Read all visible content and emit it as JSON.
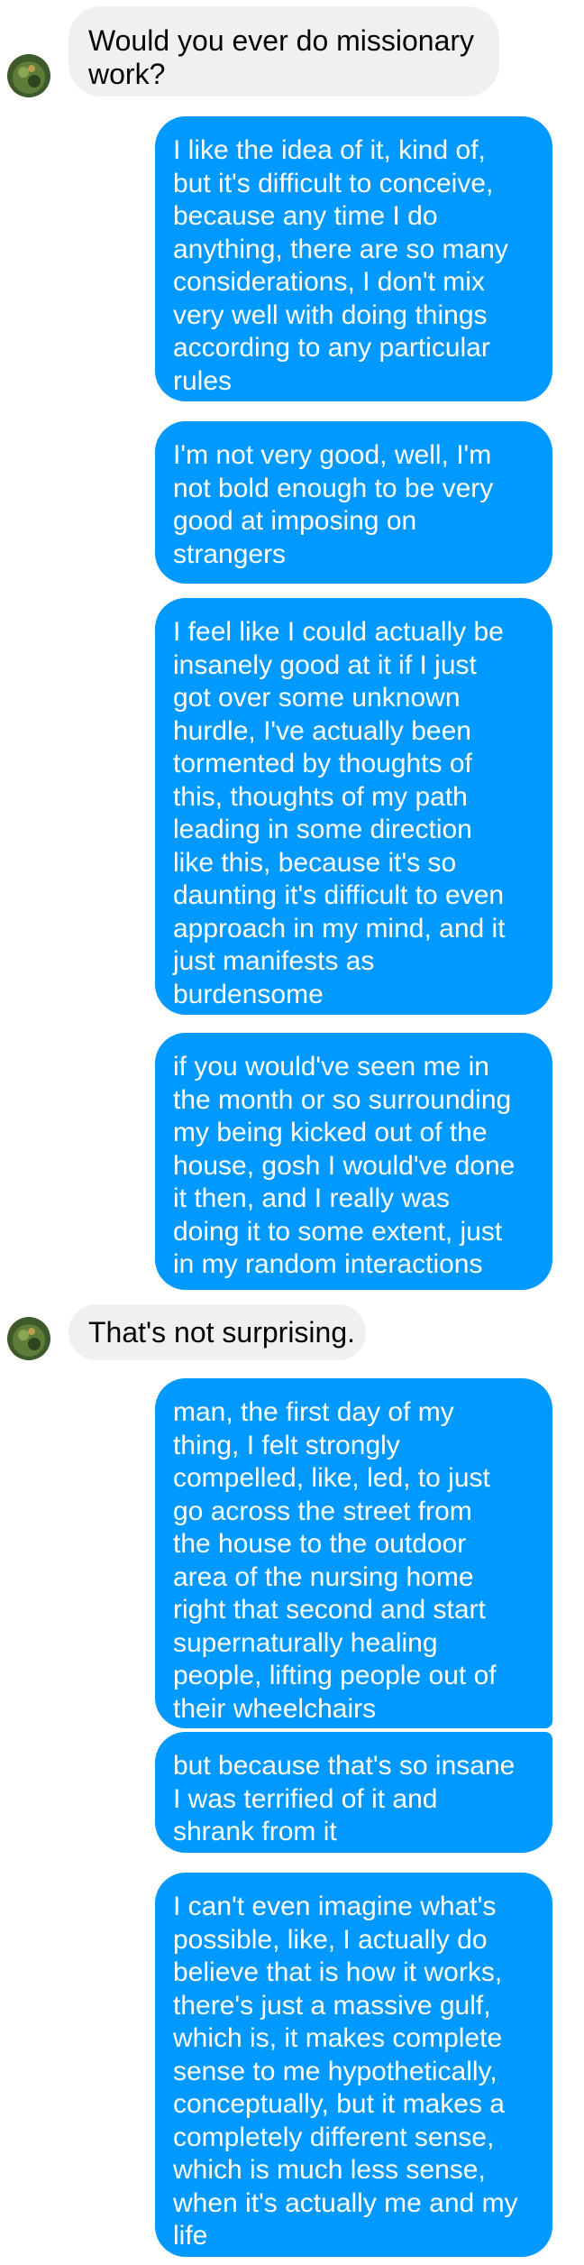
{
  "messages": [
    {
      "from": "them",
      "lines": [
        "Would you ever do missionary",
        "work?"
      ]
    },
    {
      "from": "me",
      "lines": [
        "I like the idea of it, kind of,",
        "but it's difficult to conceive,",
        "because any time I do",
        "anything, there are so many",
        "considerations, I don't mix",
        "very well with doing things",
        "according to any particular",
        "rules"
      ]
    },
    {
      "from": "me",
      "lines": [
        "I'm not very good, well, I'm",
        "not bold enough to be very",
        "good at imposing on",
        "strangers"
      ]
    },
    {
      "from": "me",
      "lines": [
        "I feel like I could actually be",
        "insanely good at it if I just",
        "got over some unknown",
        "hurdle, I've actually been",
        "tormented by thoughts of",
        "this, thoughts of my path",
        "leading in some direction",
        "like this, because it's so",
        "daunting it's difficult to even",
        "approach in my mind, and it",
        "just manifests as",
        "burdensome"
      ]
    },
    {
      "from": "me",
      "lines": [
        "if you would've seen me in",
        "the month or so surrounding",
        "my being kicked out of the",
        "house, gosh I would've done",
        "it then, and I really was",
        "doing it to some extent, just",
        "in my random interactions"
      ]
    },
    {
      "from": "them",
      "lines": [
        "That's not surprising."
      ]
    },
    {
      "from": "me",
      "lines": [
        "man, the first day of my",
        "thing, I felt strongly",
        "compelled, like, led, to just",
        "go across the street from",
        "the house to the outdoor",
        "area of the nursing home",
        "right that second and start",
        "supernaturally healing",
        "people, lifting people out of",
        "their wheelchairs"
      ]
    },
    {
      "from": "me",
      "lines": [
        "but because that's so insane",
        "I was terrified of it and",
        "shrank from it"
      ]
    },
    {
      "from": "me",
      "lines": [
        "I can't even imagine what's",
        "possible, like, I actually do",
        "believe that is how it works,",
        "there's just a massive gulf,",
        "which is, it makes complete",
        "sense to me hypothetically,",
        "conceptually, but it makes a",
        "completely different sense,",
        "which is much less sense,",
        "when it's actually me and my",
        "life"
      ]
    }
  ],
  "colors": {
    "outgoing": "#0099ff",
    "incoming": "#f1f0f0"
  },
  "icons": {
    "avatar": "contact-avatar-photo"
  }
}
